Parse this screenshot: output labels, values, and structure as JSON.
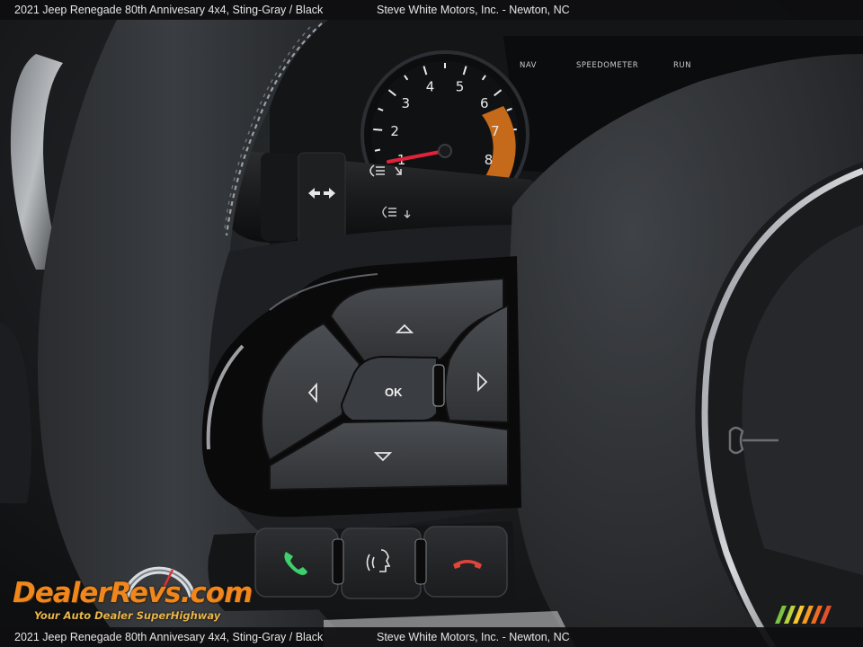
{
  "caption": {
    "vehicle": "2021 Jeep Renegade 80th Annivesary 4x4,  Sting-Gray / Black",
    "dealer": "Steve White Motors, Inc.  - Newton, NC"
  },
  "cluster": {
    "labels": [
      "NAV",
      "SPEEDOMETER",
      "RUN"
    ],
    "tach_numbers": [
      "1",
      "2",
      "3",
      "4",
      "5",
      "6",
      "7",
      "8"
    ]
  },
  "controls": {
    "ok_label": "OK"
  },
  "watermark": {
    "logo": "DealerRevs.com",
    "tagline": "Your Auto Dealer SuperHighway"
  },
  "colors": {
    "stitching": "#9aa0a6",
    "call_accept": "#3ed06b",
    "call_end": "#e0443c",
    "needle": "#e0233a",
    "redline": "#c46a1a",
    "watermark_orange": "#f0861c",
    "watermark_yellow": "#e9b64a"
  }
}
